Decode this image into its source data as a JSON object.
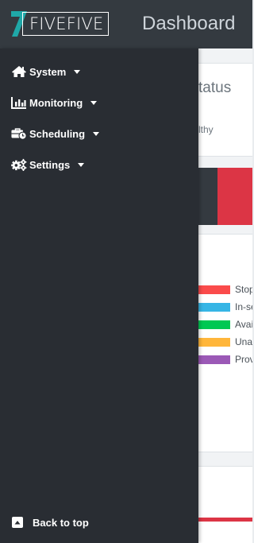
{
  "header": {
    "logo_text": "FIVEFIVE",
    "title": "Dashboard"
  },
  "sidebar": {
    "items": [
      {
        "label": "System",
        "icon": "home-icon"
      },
      {
        "label": "Monitoring",
        "icon": "chart-icon"
      },
      {
        "label": "Scheduling",
        "icon": "toolbox-clock-icon"
      },
      {
        "label": "Settings",
        "icon": "cogs-icon"
      }
    ],
    "back_to_top": {
      "label": "Back to top",
      "icon": "caret-up-square-icon"
    }
  },
  "main": {
    "status_card": {
      "title_fragment": "tatus",
      "subtitle_fragment": "lthy"
    },
    "legend": [
      {
        "label": "Stop",
        "color": "#fa4b4b"
      },
      {
        "label": "In-se",
        "color": "#36b5e5"
      },
      {
        "label": "Avai",
        "color": "#00c853"
      },
      {
        "label": "Una",
        "color": "#ffb63b"
      },
      {
        "label": "Prov",
        "color": "#9b59b6"
      }
    ]
  },
  "colors": {
    "topbar": "#343a40",
    "sidebar": "#292d33",
    "danger": "#dc3545",
    "logo_accent": "#1fa8a8"
  }
}
